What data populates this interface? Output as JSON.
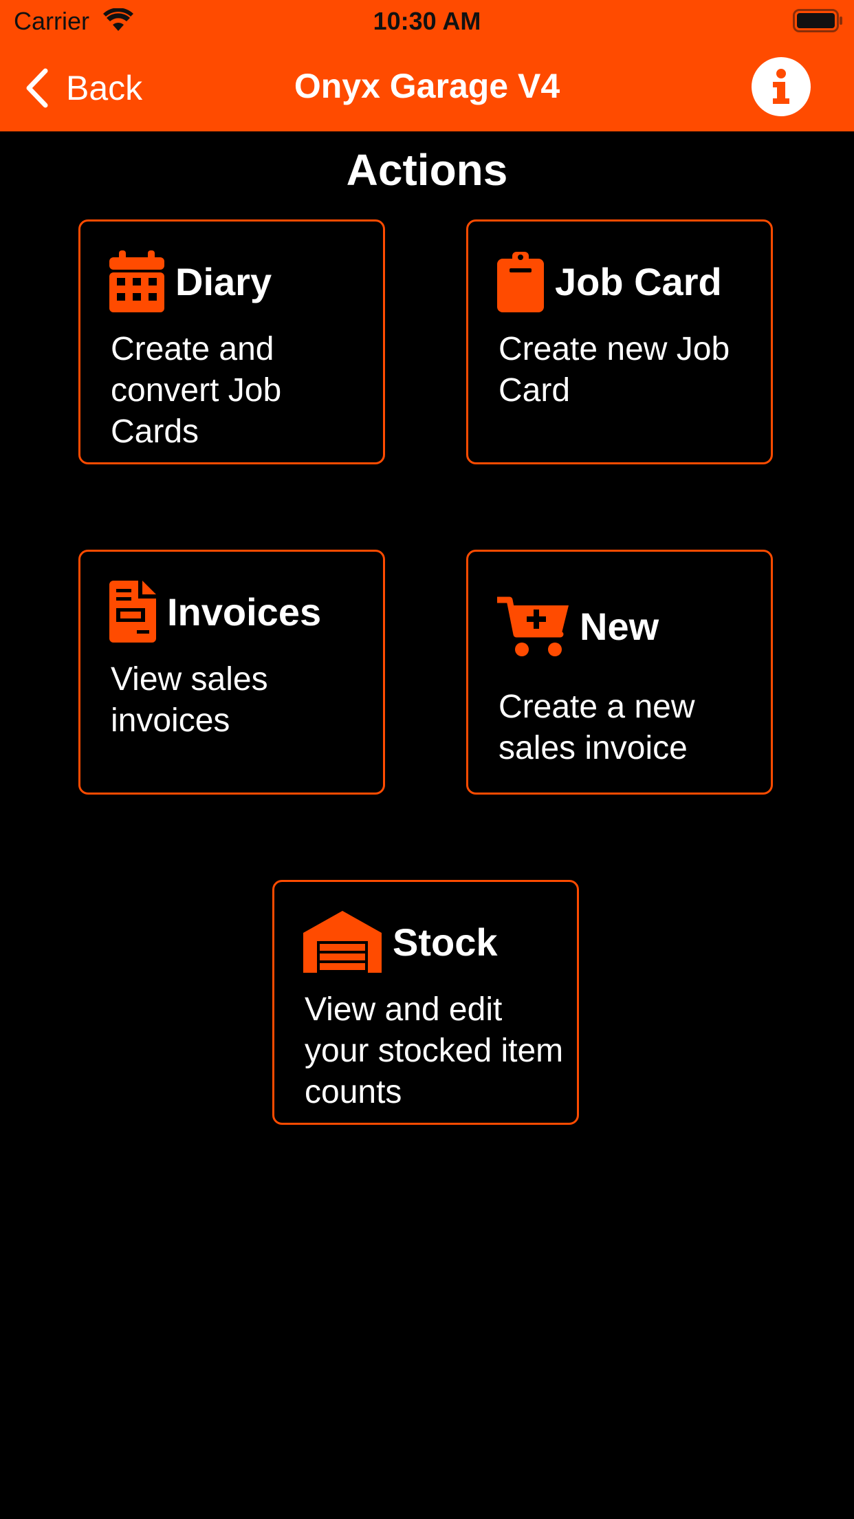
{
  "status_bar": {
    "carrier": "Carrier",
    "time": "10:30 AM"
  },
  "nav": {
    "back_label": "Back",
    "title": "Onyx Garage V4",
    "info_icon": "info-circle-icon"
  },
  "section_title": "Actions",
  "colors": {
    "accent": "#FF4B00",
    "background": "#000000",
    "text": "#FFFFFF"
  },
  "cards": [
    {
      "icon": "calendar-icon",
      "title": "Diary",
      "description": "Create and convert Job Cards"
    },
    {
      "icon": "clipboard-icon",
      "title": "Job Card",
      "description": "Create new Job Card"
    },
    {
      "icon": "invoice-document-icon",
      "title": "Invoices",
      "description": "View sales invoices"
    },
    {
      "icon": "cart-plus-icon",
      "title": "New",
      "description": "Create a new sales invoice"
    },
    {
      "icon": "warehouse-icon",
      "title": "Stock",
      "description": "View and edit your stocked item counts"
    }
  ]
}
